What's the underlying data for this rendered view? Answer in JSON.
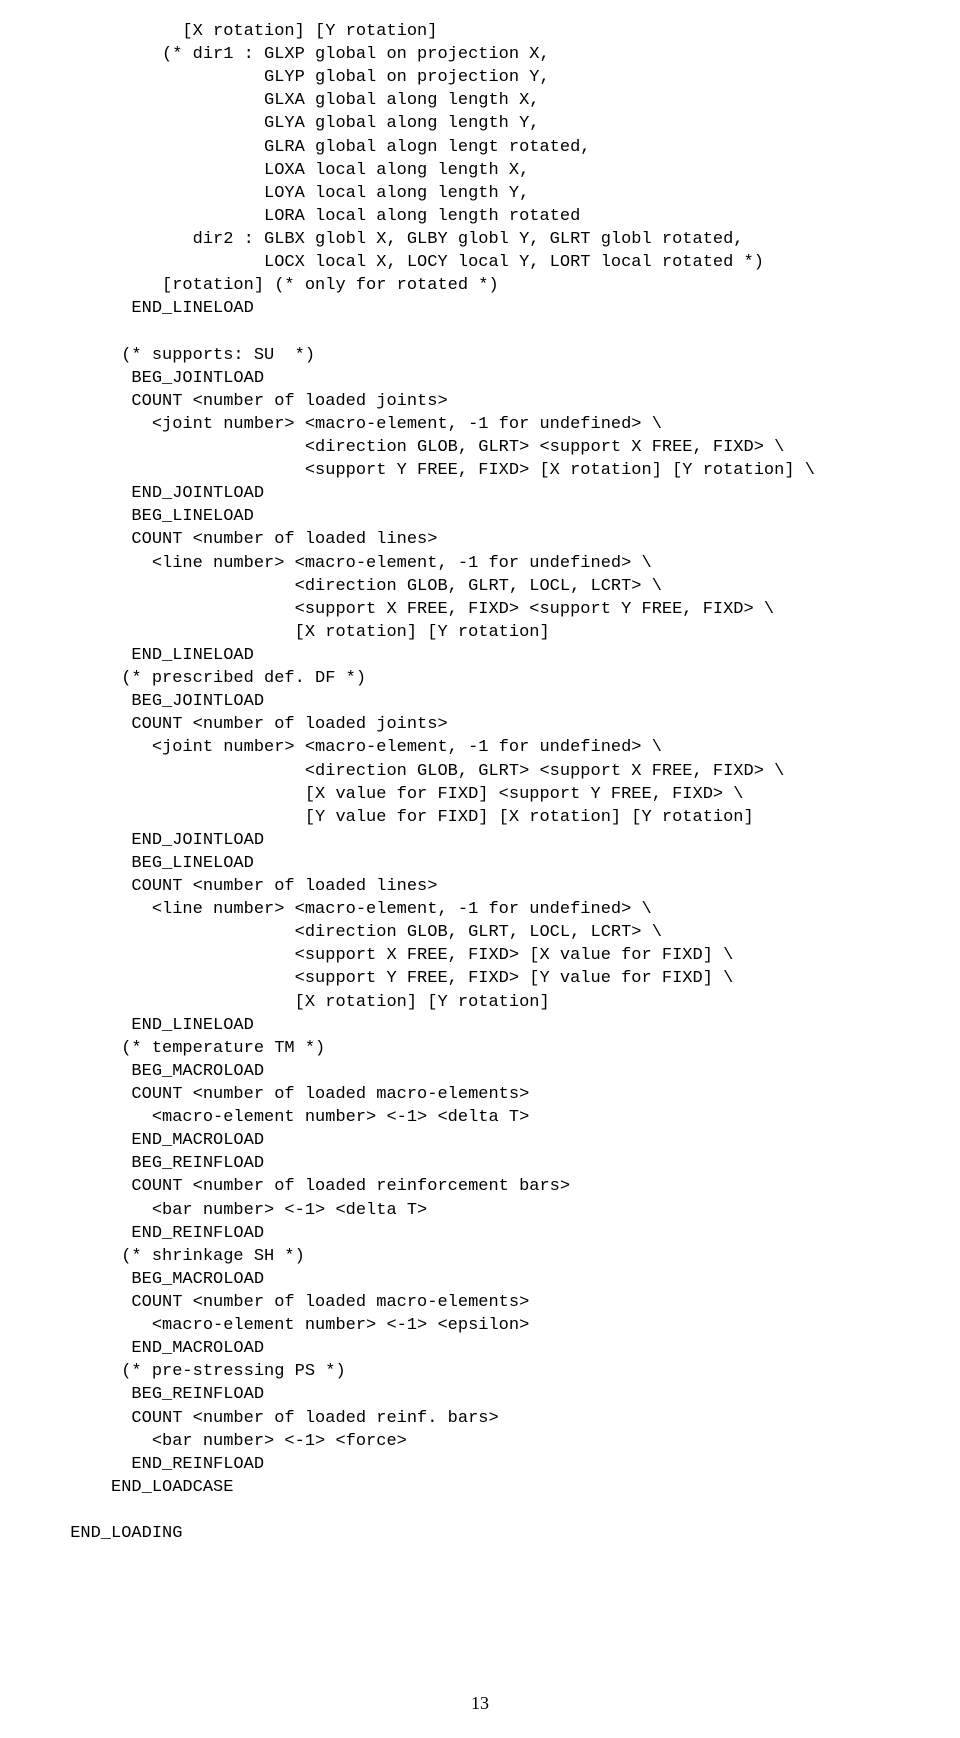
{
  "page_number": "13",
  "body_text": "            [X rotation] [Y rotation]\n          (* dir1 : GLXP global on projection X,\n                    GLYP global on projection Y,\n                    GLXA global along length X,\n                    GLYA global along length Y,\n                    GLRA global alogn lengt rotated,\n                    LOXA local along length X,\n                    LOYA local along length Y,\n                    LORA local along length rotated\n             dir2 : GLBX globl X, GLBY globl Y, GLRT globl rotated,\n                    LOCX local X, LOCY local Y, LORT local rotated *)\n          [rotation] (* only for rotated *)\n       END_LINELOAD\n\n      (* supports: SU  *)\n       BEG_JOINTLOAD\n       COUNT <number of loaded joints>\n         <joint number> <macro-element, -1 for undefined> \\\n                        <direction GLOB, GLRT> <support X FREE, FIXD> \\\n                        <support Y FREE, FIXD> [X rotation] [Y rotation] \\\n       END_JOINTLOAD\n       BEG_LINELOAD\n       COUNT <number of loaded lines>\n         <line number> <macro-element, -1 for undefined> \\\n                       <direction GLOB, GLRT, LOCL, LCRT> \\\n                       <support X FREE, FIXD> <support Y FREE, FIXD> \\\n                       [X rotation] [Y rotation]\n       END_LINELOAD\n      (* prescribed def. DF *)\n       BEG_JOINTLOAD\n       COUNT <number of loaded joints>\n         <joint number> <macro-element, -1 for undefined> \\\n                        <direction GLOB, GLRT> <support X FREE, FIXD> \\\n                        [X value for FIXD] <support Y FREE, FIXD> \\\n                        [Y value for FIXD] [X rotation] [Y rotation]\n       END_JOINTLOAD\n       BEG_LINELOAD\n       COUNT <number of loaded lines>\n         <line number> <macro-element, -1 for undefined> \\\n                       <direction GLOB, GLRT, LOCL, LCRT> \\\n                       <support X FREE, FIXD> [X value for FIXD] \\\n                       <support Y FREE, FIXD> [Y value for FIXD] \\\n                       [X rotation] [Y rotation]\n       END_LINELOAD\n      (* temperature TM *)\n       BEG_MACROLOAD\n       COUNT <number of loaded macro-elements>\n         <macro-element number> <-1> <delta T>\n       END_MACROLOAD\n       BEG_REINFLOAD\n       COUNT <number of loaded reinforcement bars>\n         <bar number> <-1> <delta T>\n       END_REINFLOAD\n      (* shrinkage SH *)\n       BEG_MACROLOAD\n       COUNT <number of loaded macro-elements>\n         <macro-element number> <-1> <epsilon>\n       END_MACROLOAD\n      (* pre-stressing PS *)\n       BEG_REINFLOAD\n       COUNT <number of loaded reinf. bars>\n         <bar number> <-1> <force>\n       END_REINFLOAD\n     END_LOADCASE\n\n END_LOADING"
}
